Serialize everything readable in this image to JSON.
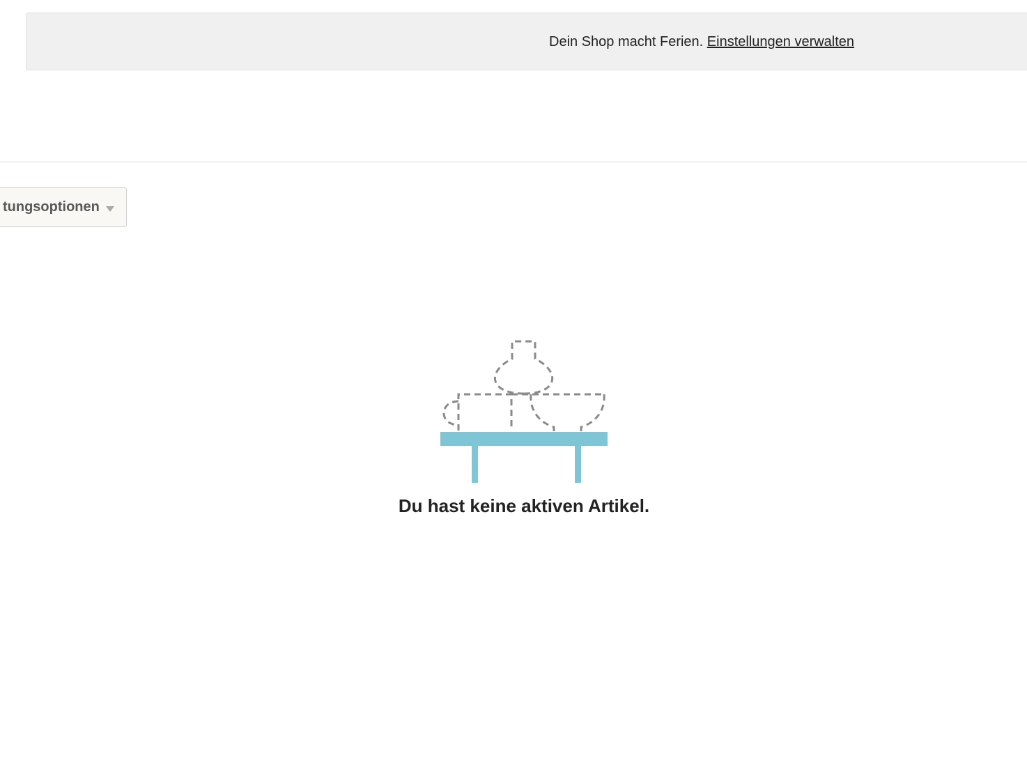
{
  "banner": {
    "message": "Dein Shop macht Ferien.",
    "link_label": "Einstellungen verwalten"
  },
  "toolbar": {
    "options_label": "tungsoptionen",
    "options_icon": "caret-down-icon"
  },
  "empty_state": {
    "illustration_icon": "empty-shelf-icon",
    "message": "Du hast keine aktiven Artikel.",
    "shelf_color": "#7ec5d6",
    "outline_color": "#8a8a8a"
  }
}
